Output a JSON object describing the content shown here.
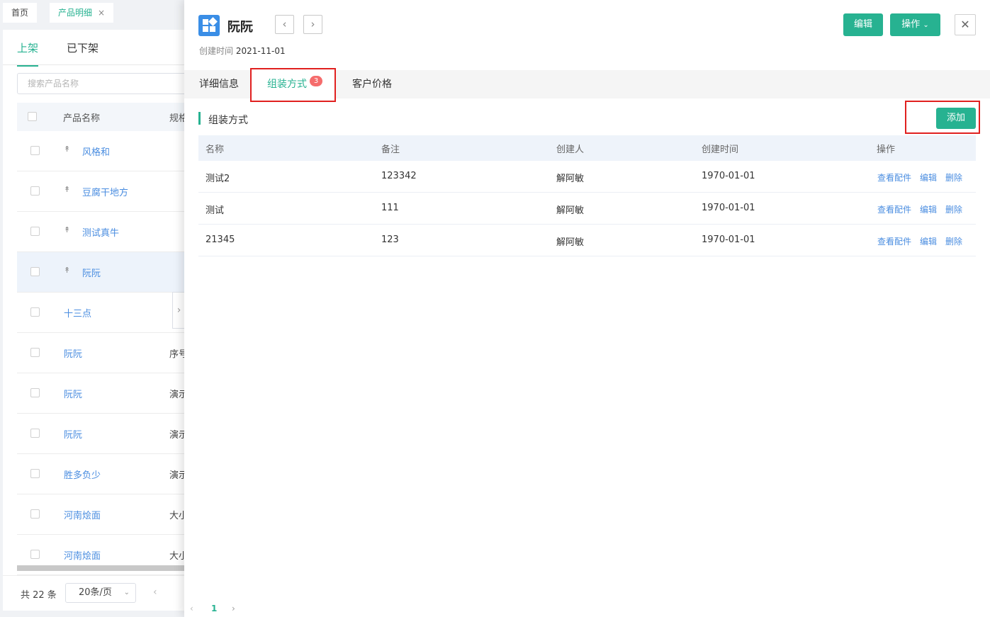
{
  "page_tabs": [
    {
      "label": "首页"
    },
    {
      "label": "产品明细",
      "close": "×"
    }
  ],
  "list": {
    "status_tabs": [
      "上架",
      "已下架"
    ],
    "search_placeholder": "搜索产品名称",
    "columns": [
      "产品名称",
      "规格"
    ],
    "rows": [
      {
        "name": "风格和",
        "pinned": true,
        "spec": ""
      },
      {
        "name": "豆腐干地方",
        "pinned": true,
        "spec": ""
      },
      {
        "name": "测试真牛",
        "pinned": true,
        "spec": ""
      },
      {
        "name": "阮阮",
        "pinned": true,
        "spec": "",
        "highlight": true
      },
      {
        "name": "十三点",
        "pinned": false,
        "spec": ""
      },
      {
        "name": "阮阮",
        "pinned": false,
        "spec": "序号"
      },
      {
        "name": "阮阮",
        "pinned": false,
        "spec": "演示"
      },
      {
        "name": "阮阮",
        "pinned": false,
        "spec": "演示"
      },
      {
        "name": "胜多负少",
        "pinned": false,
        "spec": "演示"
      },
      {
        "name": "河南烩面",
        "pinned": false,
        "spec": "大小"
      },
      {
        "name": "河南烩面",
        "pinned": false,
        "spec": "大小"
      }
    ],
    "pager": {
      "total": "共 22 条",
      "page_size": "20条/页"
    }
  },
  "drawer": {
    "title": "阮阮",
    "edit_label": "编辑",
    "ops_label": "操作",
    "created_label": "创建时间",
    "created_value": "2021-11-01",
    "tabs": [
      {
        "label": "详细信息"
      },
      {
        "label": "组装方式",
        "badge": "3"
      },
      {
        "label": "客户价格"
      }
    ],
    "section_title": "组装方式",
    "add_label": "添加",
    "table": {
      "headers": [
        "名称",
        "备注",
        "创建人",
        "创建时间",
        "操作"
      ],
      "rows": [
        {
          "name": "测试2",
          "remark": "123342",
          "creator": "解阿敏",
          "created": "1970-01-01"
        },
        {
          "name": "测试",
          "remark": "111",
          "creator": "解阿敏",
          "created": "1970-01-01"
        },
        {
          "name": "21345",
          "remark": "123",
          "creator": "解阿敏",
          "created": "1970-01-01"
        }
      ],
      "actions": [
        "查看配件",
        "编辑",
        "删除"
      ]
    },
    "pager": {
      "current": "1"
    }
  },
  "colors": {
    "accent": "#27b291",
    "link": "#4a8de0",
    "badge": "#f56c6c",
    "highlight_frame": "#e0201f"
  }
}
